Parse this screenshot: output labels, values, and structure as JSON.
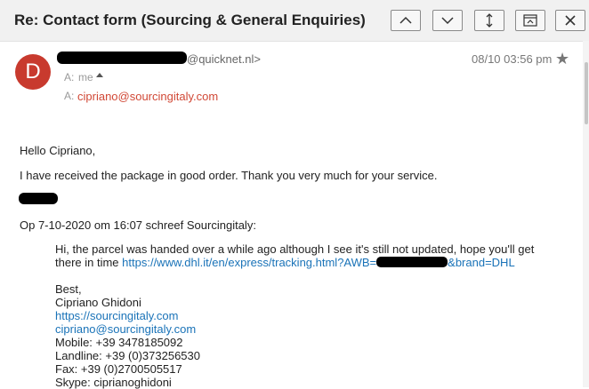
{
  "header": {
    "subject": "Re: Contact form (Sourcing & General Enquiries)"
  },
  "message": {
    "avatar_letter": "D",
    "sender_domain": "@quicknet.nl>",
    "date": "08/10 03:56 pm",
    "to_label": "A:",
    "to_value": "me",
    "cc_label": "A:",
    "cc_email": "cipriano@sourcingitaly.com"
  },
  "body": {
    "greeting": "Hello Cipriano,",
    "line1": "I have received the package in good order. Thank you very much for your service.",
    "reply_header": "Op 7-10-2020 om 16:07 schreef Sourcingitaly:"
  },
  "quote": {
    "line1": "Hi, the parcel was handed over a while ago although I see it's still not updated, hope you'll get",
    "line2_prefix": "there in time ",
    "tracking_link_start": "https://www.dhl.it/en/express/tracking.html?AWB=",
    "tracking_link_end": "&brand=DHL",
    "best": "Best,",
    "name": "Cipriano Ghidoni",
    "website": "https://sourcingitaly.com",
    "email": "cipriano@sourcingitaly.com",
    "mobile": "Mobile: +39 3478185092",
    "landline": "Landline: +39 (0)373256530",
    "fax": "Fax: +39 (0)2700505517",
    "skype": "Skype: ciprianoghidoni"
  },
  "icons": {
    "up": "chevron-up-icon",
    "down": "chevron-down-icon",
    "expand": "expand-icon",
    "print": "print-icon",
    "close": "close-icon",
    "star": "star-icon"
  },
  "colors": {
    "avatar": "#c83a2e",
    "link": "#1a73b8",
    "cc_email": "#d14836"
  }
}
